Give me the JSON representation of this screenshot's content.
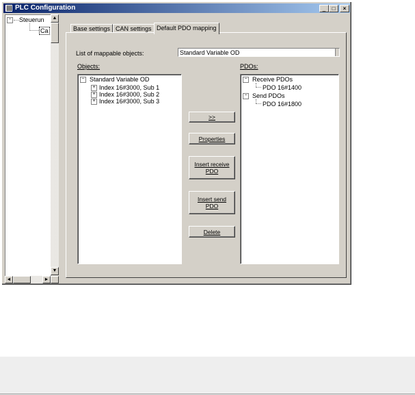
{
  "window": {
    "title": "PLC Configuration"
  },
  "controls": {
    "minimize": "_",
    "maximize": "□",
    "close": "×"
  },
  "tree": {
    "root": "Steuerun",
    "child": "Ca"
  },
  "tabs": [
    "Base settings",
    "CAN settings",
    "Default PDO mapping"
  ],
  "mappable": {
    "label": "List of mappable objects:",
    "value": "Standard Variable OD"
  },
  "objects": {
    "label": "Objects:",
    "root": "Standard Variable OD",
    "items": [
      "Index 16#3000, Sub 1",
      "Index 16#3000, Sub 2",
      "Index 16#3000, Sub 3"
    ]
  },
  "pdos": {
    "label": "PDOs:",
    "receive": "Receive PDOs",
    "receive_item": "PDO 16#1400",
    "send": "Send PDOs",
    "send_item": "PDO 16#1800"
  },
  "buttons": {
    "add": ">>",
    "properties": "Properties",
    "insert_receive": "Insert receive\nPDO",
    "insert_send": "Insert send\nPDO",
    "delete": "Delete"
  }
}
